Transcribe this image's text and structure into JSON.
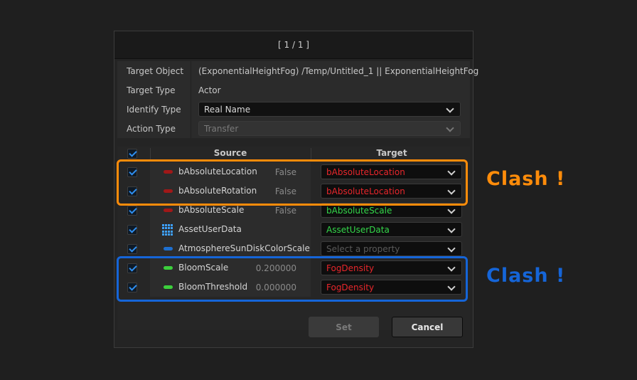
{
  "dialog": {
    "title": "[ 1 / 1 ]",
    "info": [
      {
        "label": "Target Object",
        "value": "(ExponentialHeightFog) /Temp/Untitled_1 || ExponentialHeightFog"
      },
      {
        "label": "Target Type",
        "value": "Actor"
      },
      {
        "label": "Identify Type",
        "value": "Real Name"
      },
      {
        "label": "Action Type",
        "value": "Transfer"
      }
    ],
    "columns": {
      "source": "Source",
      "target": "Target"
    },
    "rows": [
      {
        "name": "bAbsoluteLocation",
        "value": "False",
        "target": "bAbsoluteLocation",
        "target_color": "#e8262b",
        "icon_color": "#a01818"
      },
      {
        "name": "bAbsoluteRotation",
        "value": "False",
        "target": "bAbsoluteLocation",
        "target_color": "#e8262b",
        "icon_color": "#a01818"
      },
      {
        "name": "bAbsoluteScale",
        "value": "False",
        "target": "bAbsoluteScale",
        "target_color": "#34d84a",
        "icon_color": "#a01818"
      },
      {
        "name": "AssetUserData",
        "value": "",
        "target": "AssetUserData",
        "target_color": "#34d84a",
        "icon": "grid-icon"
      },
      {
        "name": "AtmosphereSunDiskColorScale",
        "value": "",
        "target": "",
        "target_placeholder": "Select a property",
        "icon_color": "#1e6fd0"
      },
      {
        "name": "BloomScale",
        "value": "0.200000",
        "target": "FogDensity",
        "target_color": "#e8262b",
        "icon_color": "#3ccf3c"
      },
      {
        "name": "BloomThreshold",
        "value": "0.000000",
        "target": "FogDensity",
        "target_color": "#e8262b",
        "icon_color": "#3ccf3c"
      }
    ],
    "buttons": {
      "set": "Set",
      "cancel": "Cancel"
    }
  },
  "annotations": {
    "clash_orange": "Clash !",
    "clash_blue": "Clash !",
    "orange_color": "#ff8c0a",
    "blue_color": "#1565d8"
  }
}
